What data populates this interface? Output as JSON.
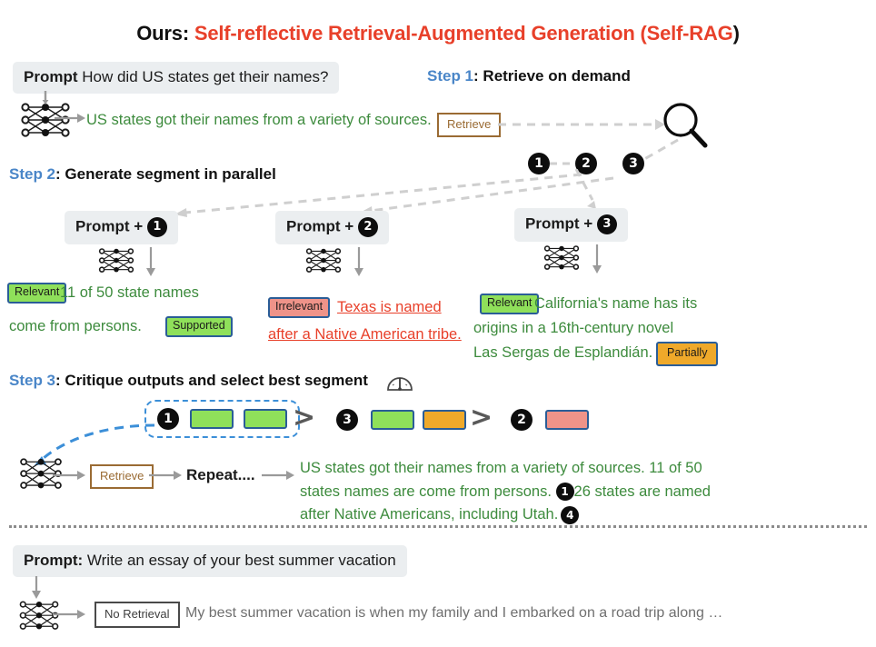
{
  "title": {
    "prefix": "Ours: ",
    "main": "Self-reflective Retrieval-Augmented Generation (",
    "short": "Self-RAG",
    "suffix": ")"
  },
  "colors": {
    "accent_red": "#e8402a",
    "step_blue": "#4a86c8",
    "generated_green": "#3d8b3d",
    "chip_border_blue": "#2a5d97",
    "chip_green": "#8fe05a",
    "chip_red": "#ef9389",
    "chip_orange": "#efa92a",
    "retrieve_brown": "#9a6b33",
    "prompt_bg": "#ebeef0"
  },
  "prompt1": {
    "label": "Prompt",
    "text": "How did US states get their names?"
  },
  "step1": {
    "blue": "Step 1",
    "rest": ": Retrieve on demand",
    "generated": "US states got their names from a variety of sources.",
    "retrieve_token": "Retrieve",
    "search_icon": "magnifier-icon",
    "passages": [
      "1",
      "2",
      "3"
    ]
  },
  "step2": {
    "blue": "Step 2",
    "rest": ": Generate segment in parallel",
    "columns": [
      {
        "prompt_label": "Prompt + ",
        "passage": "1",
        "relevance_chip": "Relevant",
        "support_chip": "Supported",
        "text_line1": "11 of 50 state names",
        "text_line2": "come from persons.",
        "text_color": "green"
      },
      {
        "prompt_label": "Prompt + ",
        "passage": "2",
        "relevance_chip": "Irrelevant",
        "support_chip": "",
        "text_line1": "Texas is named",
        "text_line2": "after a Native American tribe.",
        "text_color": "red"
      },
      {
        "prompt_label": "Prompt + ",
        "passage": "3",
        "relevance_chip": "Relevant",
        "support_chip": "Partially",
        "text_line1": "California's name has its",
        "text_line2": "origins  in  a  16th-century  novel",
        "text_line3": "Las Sergas de Esplandián.",
        "text_color": "green"
      }
    ]
  },
  "step3": {
    "blue": "Step 3",
    "rest": ": Critique outputs and select best segment",
    "gauge_icon": "gauge-icon",
    "ranking": [
      {
        "passage": "1",
        "swatches": [
          "green",
          "green"
        ],
        "selected": true
      },
      {
        "passage": "3",
        "swatches": [
          "green",
          "orange"
        ],
        "selected": false
      },
      {
        "passage": "2",
        "swatches": [
          "red"
        ],
        "selected": false
      }
    ],
    "gt_symbol": ">",
    "retrieve_token": "Retrieve",
    "repeat_label": "Repeat....",
    "final_line1": "US states got their names from a variety of sources. 11 of 50",
    "final_line2a": "states names are come from persons. ",
    "final_cite1": "1",
    "final_line2b": "26 states are named",
    "final_line3a": "after Native Americans, including Utah.",
    "final_cite2": "4"
  },
  "prompt2": {
    "label": "Prompt:",
    "text": " Write an essay of your best summer vacation",
    "no_retrieval_token": "No Retrieval",
    "generated": "My best summer vacation is when my family and I embarked on a road trip along …"
  }
}
